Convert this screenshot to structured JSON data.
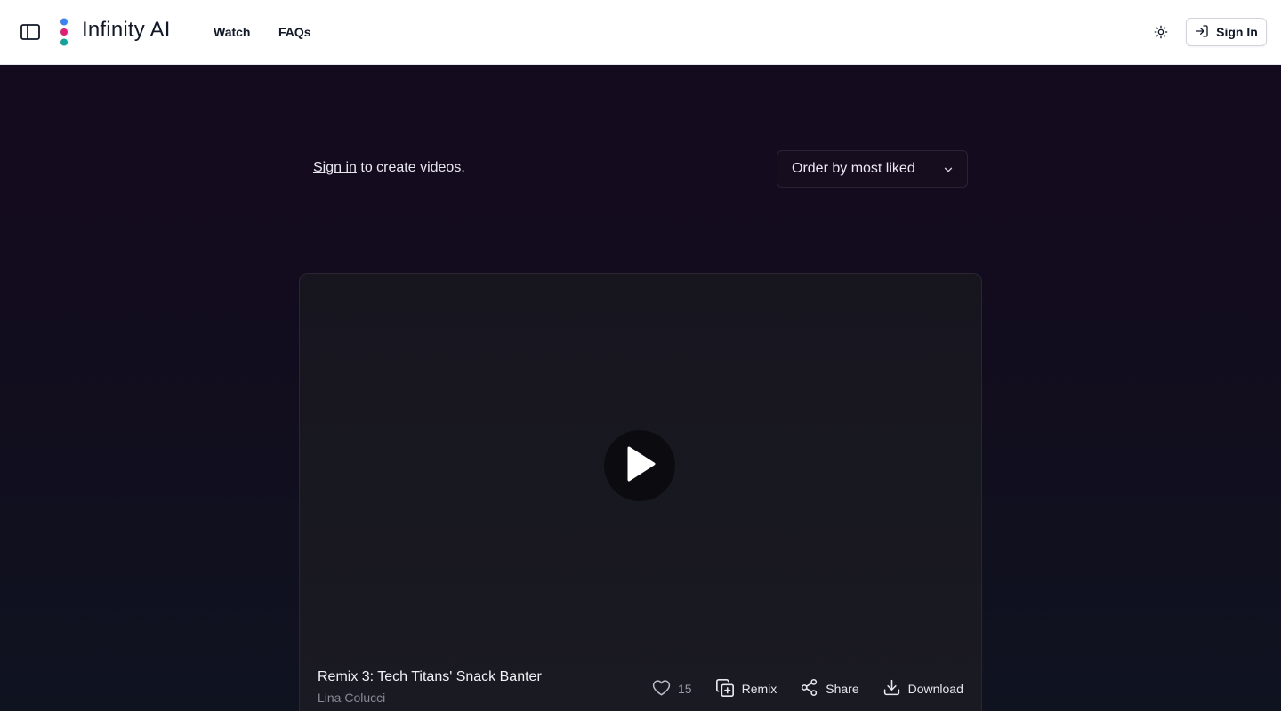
{
  "header": {
    "brand": "Infinity AI",
    "nav": [
      {
        "label": "Watch"
      },
      {
        "label": "FAQs"
      }
    ],
    "signin_label": "Sign In",
    "icons": {
      "sidebar": "sidebar-toggle-icon",
      "theme": "sun-icon",
      "signin": "log-in-icon"
    },
    "logo_colors": [
      "#3b82f6",
      "#e11d74",
      "#14a39a"
    ]
  },
  "main": {
    "signin_link": "Sign in",
    "signin_suffix": " to create videos.",
    "order_select": {
      "selected": "Order by most liked"
    }
  },
  "video": {
    "title": "Remix 3: Tech Titans' Snack Banter",
    "author": "Lina Colucci",
    "likes": "15",
    "actions": {
      "remix": "Remix",
      "share": "Share",
      "download": "Download"
    }
  },
  "colors": {
    "background": "#140c1c",
    "card": "#17161f",
    "header": "#ffffff"
  }
}
